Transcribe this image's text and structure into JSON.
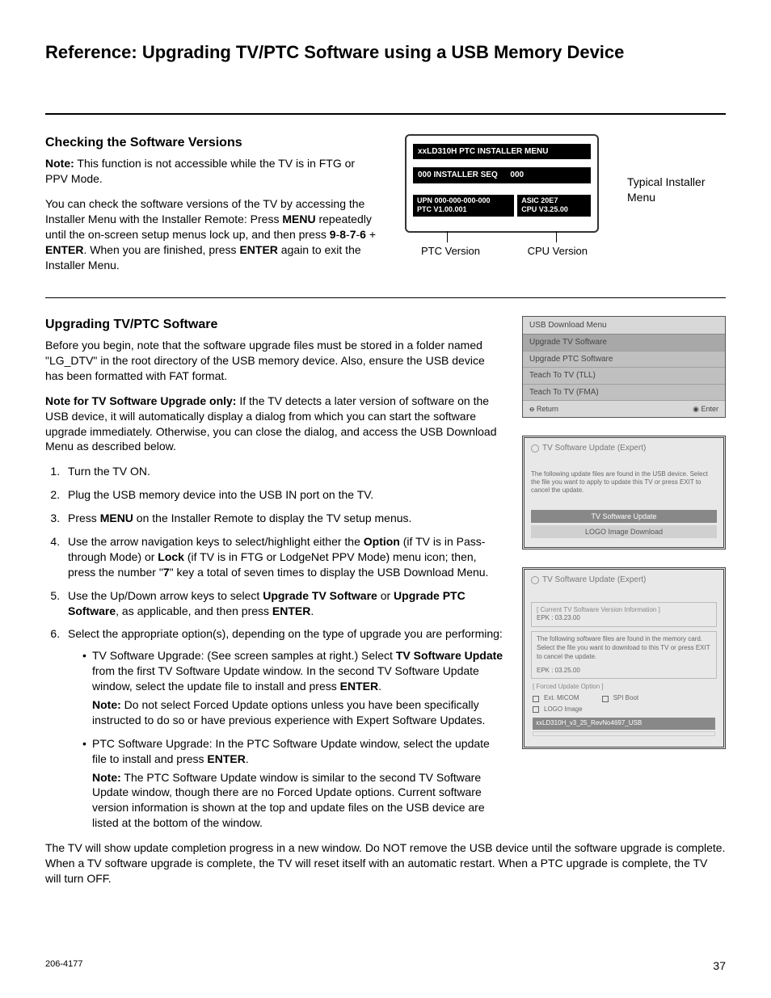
{
  "page": {
    "title": "Reference: Upgrading TV/PTC Software using a USB Memory Device",
    "docnum": "206-4177",
    "pagenum": "37"
  },
  "s1": {
    "heading": "Checking the Software Versions",
    "note": "Note: This function is not accessible while the TV is in FTG or PPV Mode.",
    "body": "You can check the software versions of the TV by accessing the Installer Menu with the Installer Remote: Press MENU repeatedly until the on-screen setup menus lock up, and then press 9-8-7-6 + ENTER. When you are finished, press ENTER again to exit the Installer Menu.",
    "side_label": "Typical Installer Menu",
    "ptc_label": "PTC Version",
    "cpu_label": "CPU Version"
  },
  "installer": {
    "title": "xxLD310H  PTC  INSTALLER  MENU",
    "row1a": "000   INSTALLER SEQ",
    "row1b": "000",
    "upn": "UPN  000-000-000-000",
    "ptc": "PTC  V1.00.001",
    "asic": "ASIC  20E7",
    "cpu": "CPU  V3.25.00"
  },
  "s2": {
    "heading": "Upgrading TV/PTC Software",
    "p1": "Before you begin, note that the software upgrade ﬁles must be stored in a folder named \"LG_DTV\" in the root directory of the USB memory device. Also, ensure the USB device has been formatted with FAT format.",
    "p2": "Note for TV Software Upgrade only: If the TV detects a later version of software on the USB device, it will automatically display a dialog from which you can start the software upgrade immediately. Otherwise, you can close the dialog, and access the USB Download Menu as described below.",
    "steps": {
      "s1": "Turn the TV ON.",
      "s2": "Plug the USB memory device into the USB IN port on the TV.",
      "s3": "Press MENU on the Installer Remote to display the TV setup menus.",
      "s4": "Use the arrow navigation keys to select/highlight either the Option (if TV is in Pass-through Mode) or Lock (if TV is in FTG or LodgeNet PPV Mode) menu icon; then, press the number \"7\" key a total of seven times to display the USB Download Menu.",
      "s5": "Use the Up/Down arrow keys to select Upgrade TV Software or Upgrade PTC Software, as applicable, and then press ENTER.",
      "s6": "Select the appropriate option(s), depending on the type of upgrade you are performing:",
      "s6a1": "TV Software Upgrade: (See screen samples at right.) Select TV Software Update from the ﬁrst TV Software Update window. In the second TV Software Update window, select the update ﬁle to install and press ENTER.",
      "s6a2": "Note: Do not select Forced Update options unless you have been speciﬁcally instructed to do so or have previous experience with Expert Software Updates.",
      "s6b1": "PTC Software Upgrade: In the PTC Software Update window, select the update ﬁle to install and press ENTER.",
      "s6b2": "Note: The PTC Software Update window is similar to the second TV Software Update window, though there are no Forced Update options. Current software version information is shown at the top and update ﬁles on the USB device are listed at the bottom of the window."
    },
    "tail": "The TV will show update completion progress in a new window. Do NOT remove the USB device until the software upgrade is complete. When a TV software upgrade is complete, the TV will reset itself with an automatic restart. When a PTC upgrade is complete, the TV will turn OFF."
  },
  "usb": {
    "title": "USB Download Menu",
    "i1": "Upgrade TV Software",
    "i2": "Upgrade PTC Software",
    "i3": "Teach To TV (TLL)",
    "i4": "Teach To TV (FMA)",
    "return": "Return",
    "enter": "Enter"
  },
  "tv1": {
    "title": "TV Software Update (Expert)",
    "msg": "The following update files are found in the USB device. Select the file you want to apply to update this TV or press EXIT to cancel the update.",
    "btn1": "TV Software Update",
    "btn2": "LOGO Image Download"
  },
  "tv2": {
    "title": "TV Software Update (Expert)",
    "cur_hdr": "[ Current TV Software Version Information ]",
    "cur_ver": "EPK : 03.23.00",
    "msg": "The following software files are found in the memory card. Select the file you want to download to this TV or press EXIT to cancel the update.",
    "new_ver": "EPK : 03.25.00",
    "forced_hdr": "[ Forced Update Option ]",
    "opt1": "Ext. MICOM",
    "opt2": "SPI Boot",
    "opt3": "LOGO Image",
    "file": "xxLD310H_v3_25_RevNo4697_USB"
  }
}
